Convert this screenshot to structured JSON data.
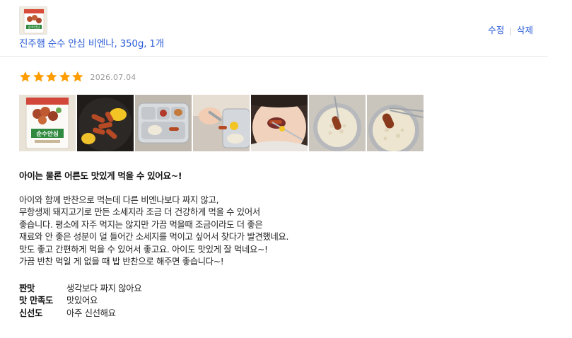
{
  "product": {
    "name": "진주햄 순수 안심 비엔나, 350g, 1개",
    "thumbnail_text": "순수안심"
  },
  "actions": {
    "edit": "수정",
    "delete": "삭제"
  },
  "review": {
    "rating": 5,
    "rating_max": 5,
    "date": "2026.07.04",
    "headline": "아이는 물론 어른도 맛있게 먹을 수 있어요~!",
    "body_lines": [
      "아이와 함께 반찬으로 먹는데 다른 비엔나보다 짜지 않고,",
      "무항생제 돼지고기로 만든 소세지라 조금 더 건강하게 먹을 수 있어서",
      "좋습니다. 평소에 자주 먹지는 않지만 가끔 먹을때 조금이라도 더 좋은",
      "재료와 안 좋은 성분이 덜 들어간 소세지를 먹이고 싶어서 찾다가 발견했네요.",
      "맛도 좋고 간편하게 먹을 수 있어서 좋고요. 아이도 맛있게 잘 먹네요~!",
      "가끔 반찬 먹일 게 없을 때 밥 반찬으로 해주면 좋습니다~!"
    ],
    "photos": [
      {
        "kind": "package",
        "text": "순수안심"
      },
      {
        "kind": "frying-pan"
      },
      {
        "kind": "food-tray"
      },
      {
        "kind": "picking-sausage"
      },
      {
        "kind": "eating"
      },
      {
        "kind": "rice-bowl"
      },
      {
        "kind": "rice-bowl-close"
      }
    ],
    "attributes": [
      {
        "key": "짠맛",
        "value": "생각보다 짜지 않아요"
      },
      {
        "key": "맛 만족도",
        "value": "맛있어요"
      },
      {
        "key": "신선도",
        "value": "아주 신선해요"
      }
    ]
  },
  "colors": {
    "link": "#2a5bd7",
    "star": "#ff9d00",
    "date": "#9a9a9a",
    "divider": "#e8e8e8"
  },
  "icons": {
    "star": "star-icon"
  }
}
